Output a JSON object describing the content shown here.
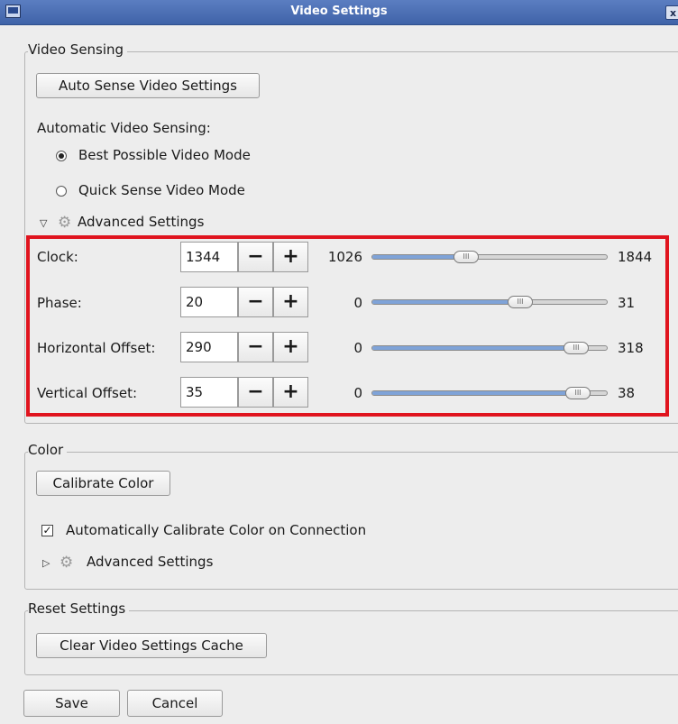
{
  "window": {
    "title": "Video Settings",
    "close_label": "x"
  },
  "video_sensing": {
    "legend": "Video Sensing",
    "auto_sense_button": "Auto Sense Video Settings",
    "automatic_label": "Automatic Video Sensing:",
    "options": [
      {
        "label": "Best Possible Video Mode",
        "selected": true
      },
      {
        "label": "Quick Sense Video Mode",
        "selected": false
      }
    ],
    "advanced_label": "Advanced Settings",
    "advanced_expanded": true,
    "rows": [
      {
        "label": "Clock:",
        "value": "1344",
        "min": "1026",
        "max": "1844",
        "fraction": 0.39
      },
      {
        "label": "Phase:",
        "value": "20",
        "min": "0",
        "max": "31",
        "fraction": 0.645
      },
      {
        "label": "Horizontal Offset:",
        "value": "290",
        "min": "0",
        "max": "318",
        "fraction": 0.912
      },
      {
        "label": "Vertical Offset:",
        "value": "35",
        "min": "0",
        "max": "38",
        "fraction": 0.921
      }
    ],
    "minus_label": "−",
    "plus_label": "+"
  },
  "color": {
    "legend": "Color",
    "calibrate_button": "Calibrate Color",
    "auto_calibrate_label": "Automatically Calibrate Color on Connection",
    "auto_calibrate_checked": true,
    "advanced_label": "Advanced Settings",
    "advanced_expanded": false
  },
  "reset": {
    "legend": "Reset Settings",
    "clear_cache_button": "Clear Video Settings Cache"
  },
  "footer": {
    "save_label": "Save",
    "cancel_label": "Cancel"
  },
  "colors": {
    "highlight": "#e0141e",
    "slider_fill": "#7fa3d8",
    "titlebar": "#4a6fb4"
  }
}
